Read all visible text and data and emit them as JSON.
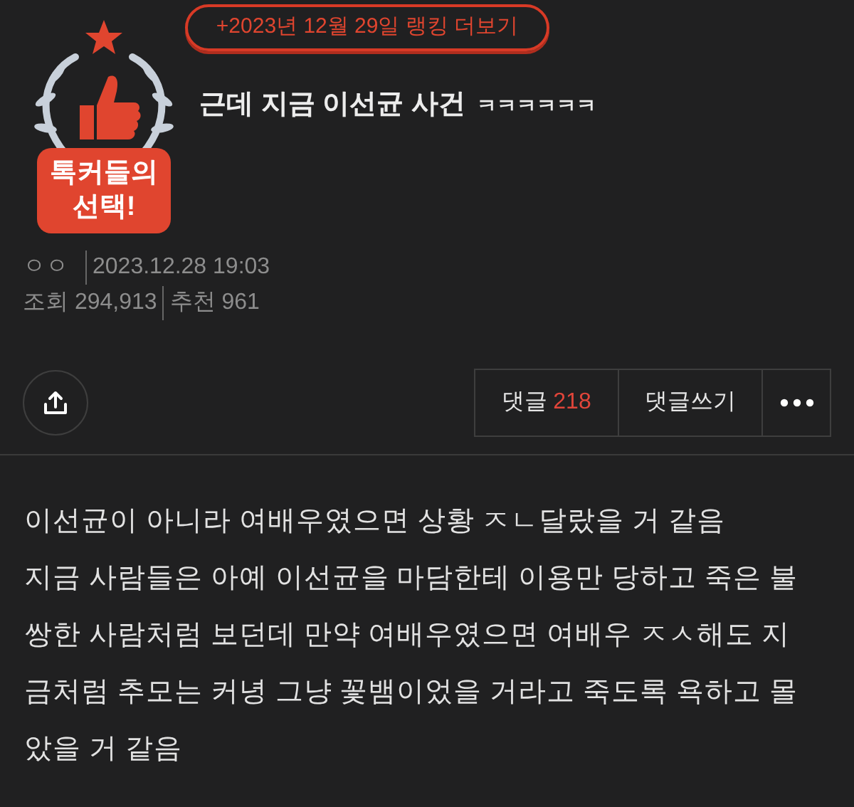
{
  "ranking_link": "+2023년 12월 29일 랭킹 더보기",
  "badge": {
    "lines": [
      "톡커들의",
      "선택!"
    ]
  },
  "post": {
    "title": "근데 지금 이선균 사건",
    "title_suffix": "ㅋㅋㅋㅋㅋㅋ",
    "author": "ㅇㅇ",
    "date": "2023.12.28 19:03",
    "views_label": "조회",
    "views": "294,913",
    "likes_label": "추천",
    "likes": "961"
  },
  "actions": {
    "comments_label": "댓글",
    "comments_count": "218",
    "write_comment": "댓글쓰기"
  },
  "body_lines": [
    "이선균이 아니라 여배우였으면 상황 ㅈㄴ달랐을 거 같음",
    "지금 사람들은 아예 이선균을 마담한테 이용만 당하고 죽은 불",
    "쌍한 사람처럼 보던데 만약 여배우였으면 여배우 ㅈㅅ해도 지",
    "금처럼 추모는 커녕 그냥 꽃뱀이었을 거라고 죽도록 욕하고 몰",
    "았을 거 같음"
  ]
}
